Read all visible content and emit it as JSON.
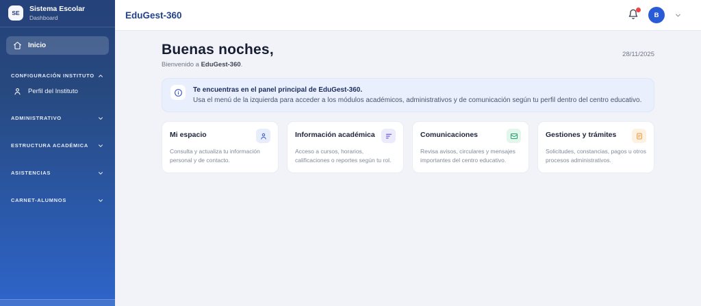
{
  "colors": {
    "sidebar_top": "#25427a",
    "sidebar_bottom": "#2e65ca",
    "brand_blue": "#21418e",
    "avatar_blue": "#2a5bd7",
    "notification_red": "#ee4444",
    "banner_bg": "#e9effc"
  },
  "sidebar": {
    "logo_initials": "SE",
    "brand": "Sistema Escolar",
    "brand_sub": "Dashboard",
    "home_label": "Inicio",
    "sections": [
      {
        "label": "CONFIGURACIÓN INSTITUTO",
        "expanded": true
      },
      {
        "label": "ADMINISTRATIVO",
        "expanded": false
      },
      {
        "label": "ESTRUCTURA ACADÉMICA",
        "expanded": false
      },
      {
        "label": "ASISTENCIAS",
        "expanded": false
      },
      {
        "label": "CARNET-ALUMNOS",
        "expanded": false
      }
    ],
    "profile_item": "Perfil del Instituto"
  },
  "topbar": {
    "brand": "EduGest-360",
    "avatar_initial": "B"
  },
  "main": {
    "greeting": "Buenas noches,",
    "welcome_prefix": "Bienvenido a ",
    "welcome_brand": "EduGest-360",
    "welcome_suffix": ".",
    "date": "28/11/2025",
    "banner": {
      "title": "Te encuentras en el panel principal de EduGest-360.",
      "subtitle": "Usa el menú de la izquierda para acceder a los módulos académicos, administrativos y de comunicación según tu perfil dentro del centro educativo."
    },
    "cards": [
      {
        "title": "Mi espacio",
        "description": "Consulta y actualiza tu información personal y de contacto.",
        "icon": "user-icon",
        "accent": "#3b62d8",
        "icon_bg": "#e7edfb"
      },
      {
        "title": "Información académica",
        "description": "Acceso a cursos, horarios, calificaciones o reportes según tu rol.",
        "icon": "bars-icon",
        "accent": "#6d5ce0",
        "icon_bg": "#ecebfc"
      },
      {
        "title": "Comunicaciones",
        "description": "Revisa avisos, circulares y mensajes importantes del centro educativo.",
        "icon": "mail-icon",
        "accent": "#1fa06a",
        "icon_bg": "#e2f6ec"
      },
      {
        "title": "Gestiones y trámites",
        "description": "Solicitudes, constancias, pagos u otros procesos administrativos.",
        "icon": "document-icon",
        "accent": "#e8943c",
        "icon_bg": "#fdf2e2"
      }
    ]
  }
}
